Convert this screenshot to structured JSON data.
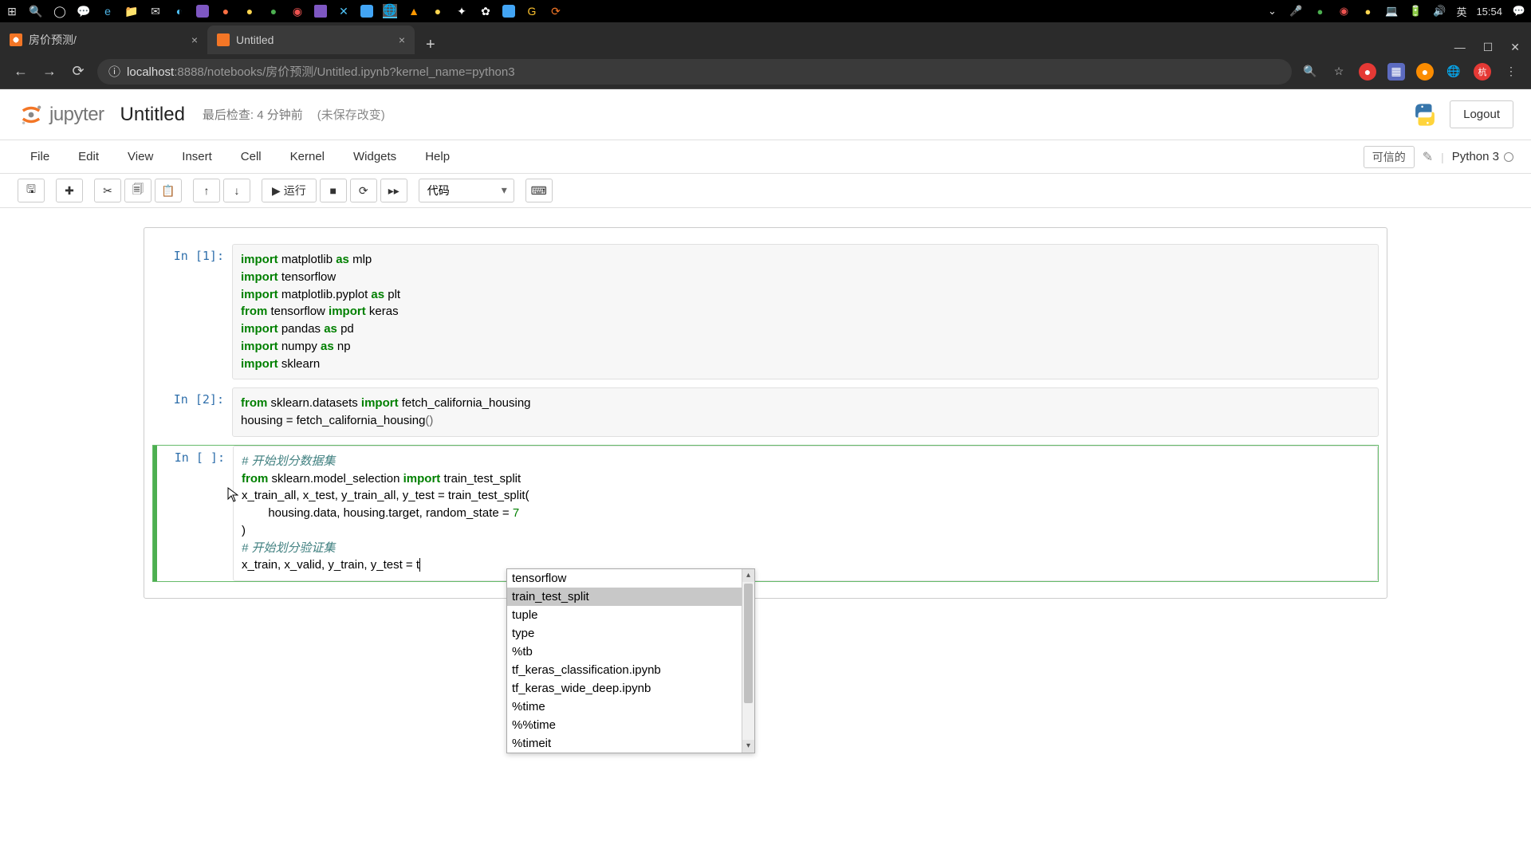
{
  "taskbar": {
    "time": "15:54",
    "ime": "英"
  },
  "browser": {
    "tabs": [
      {
        "title": "房价预测/",
        "favicon_color": "#f37626"
      },
      {
        "title": "Untitled",
        "favicon_color": "#f37626"
      }
    ],
    "url_host": "localhost",
    "url_rest": ":8888/notebooks/房价预测/Untitled.ipynb?kernel_name=python3",
    "profile_badge": "杭"
  },
  "header": {
    "logo_text": "jupyter",
    "nb_title": "Untitled",
    "last_check": "最后检查: 4 分钟前",
    "unsaved": "(未保存改变)",
    "logout": "Logout"
  },
  "menubar": {
    "items": [
      "File",
      "Edit",
      "View",
      "Insert",
      "Cell",
      "Kernel",
      "Widgets",
      "Help"
    ],
    "trusted": "可信的",
    "kernel": "Python 3"
  },
  "toolbar": {
    "run_label": "运行",
    "cell_type": "代码"
  },
  "cells": [
    {
      "prompt": "In [1]:",
      "code": [
        {
          "t": "kw",
          "v": "import"
        },
        {
          "t": "nm",
          "v": " matplotlib "
        },
        {
          "t": "kw",
          "v": "as"
        },
        {
          "t": "nm",
          "v": " mlp\n"
        },
        {
          "t": "kw",
          "v": "import"
        },
        {
          "t": "nm",
          "v": " tensorflow\n"
        },
        {
          "t": "kw",
          "v": "import"
        },
        {
          "t": "nm",
          "v": " matplotlib.pyplot "
        },
        {
          "t": "kw",
          "v": "as"
        },
        {
          "t": "nm",
          "v": " plt\n"
        },
        {
          "t": "kw",
          "v": "from"
        },
        {
          "t": "nm",
          "v": " tensorflow "
        },
        {
          "t": "kw",
          "v": "import"
        },
        {
          "t": "nm",
          "v": " keras\n"
        },
        {
          "t": "kw",
          "v": "import"
        },
        {
          "t": "nm",
          "v": " pandas "
        },
        {
          "t": "kw",
          "v": "as"
        },
        {
          "t": "nm",
          "v": " pd\n"
        },
        {
          "t": "kw",
          "v": "import"
        },
        {
          "t": "nm",
          "v": " numpy "
        },
        {
          "t": "kw",
          "v": "as"
        },
        {
          "t": "nm",
          "v": " np\n"
        },
        {
          "t": "kw",
          "v": "import"
        },
        {
          "t": "nm",
          "v": " sklearn"
        }
      ]
    },
    {
      "prompt": "In [2]:",
      "code": [
        {
          "t": "kw",
          "v": "from"
        },
        {
          "t": "nm",
          "v": " sklearn.datasets "
        },
        {
          "t": "kw",
          "v": "import"
        },
        {
          "t": "nm",
          "v": " fetch_california_housing\n"
        },
        {
          "t": "nm",
          "v": "housing = fetch_california_housing"
        },
        {
          "t": "pn",
          "v": "()"
        }
      ]
    },
    {
      "prompt": "In [ ]:",
      "active": true,
      "code": [
        {
          "t": "cm",
          "v": "# 开始划分数据集"
        },
        {
          "t": "nm",
          "v": "\n"
        },
        {
          "t": "kw",
          "v": "from"
        },
        {
          "t": "nm",
          "v": " sklearn.model_selection "
        },
        {
          "t": "kw",
          "v": "import"
        },
        {
          "t": "nm",
          "v": " train_test_split\n"
        },
        {
          "t": "nm",
          "v": "x_train_all, x_test, y_train_all, y_test = train_test_split(\n"
        },
        {
          "t": "nm",
          "v": "        housing.data, housing.target, random_state = "
        },
        {
          "t": "num",
          "v": "7"
        },
        {
          "t": "nm",
          "v": "\n"
        },
        {
          "t": "nm",
          "v": ")\n"
        },
        {
          "t": "cm",
          "v": "# 开始划分验证集"
        },
        {
          "t": "nm",
          "v": "\n"
        },
        {
          "t": "nm",
          "v": "x_train, x_valid, y_train, y_test = t"
        }
      ]
    }
  ],
  "autocomplete": {
    "selected_index": 1,
    "items": [
      "tensorflow",
      "train_test_split",
      "tuple",
      "type",
      "%tb",
      "tf_keras_classification.ipynb",
      "tf_keras_wide_deep.ipynb",
      "%time",
      "%%time",
      "%timeit"
    ]
  }
}
